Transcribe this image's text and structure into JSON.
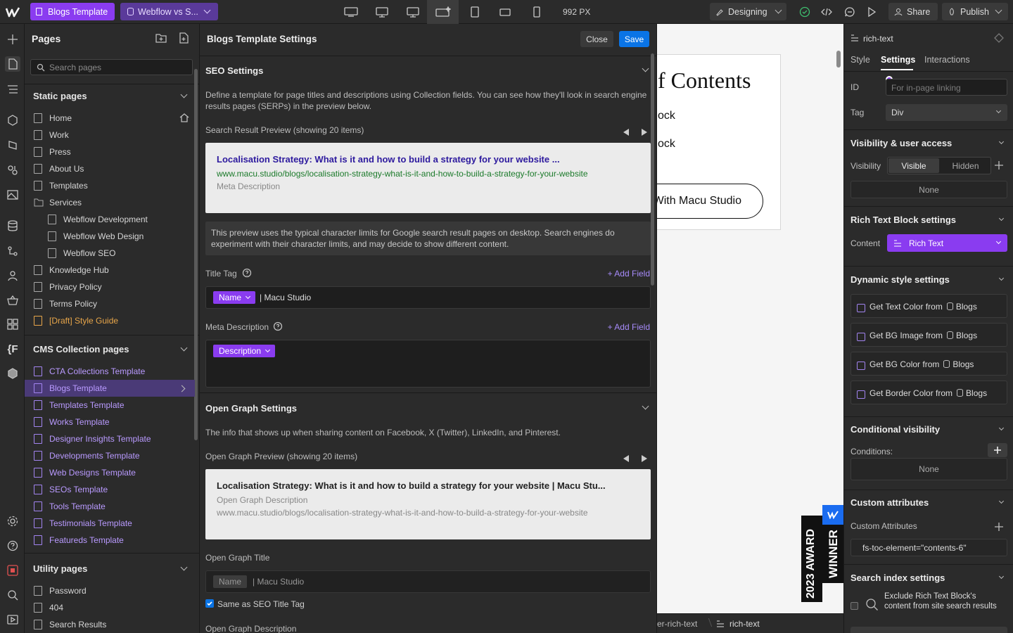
{
  "topbar": {
    "page_pill": "Blogs Template",
    "site_pill": "Webflow vs S...",
    "width_label": "992 PX",
    "mode_label": "Designing",
    "share_label": "Share",
    "publish_label": "Publish"
  },
  "pages_panel": {
    "title": "Pages",
    "search_placeholder": "Search pages",
    "static_title": "Static pages",
    "static_pages": [
      "Home",
      "Work",
      "Press",
      "About Us",
      "Templates",
      "Services",
      "Webflow Development",
      "Webflow Web Design",
      "Webflow SEO",
      "Knowledge Hub",
      "Privacy Policy",
      "Terms Policy",
      "[Draft] Style Guide"
    ],
    "cms_title": "CMS Collection pages",
    "cms_pages": [
      "CTA Collections Template",
      "Blogs Template",
      "Templates Template",
      "Works Template",
      "Designer Insights Template",
      "Developments Template",
      "Web Designs Template",
      "SEOs Template",
      "Tools Template",
      "Testimonials Template",
      "Featureds Template"
    ],
    "utility_title": "Utility pages",
    "utility_pages": [
      "Password",
      "404",
      "Search Results"
    ]
  },
  "settings": {
    "title": "Blogs Template Settings",
    "close_label": "Close",
    "save_label": "Save",
    "seo_title": "SEO Settings",
    "seo_desc": "Define a template for page titles and descriptions using Collection fields. You can see how they'll look in search engine results pages (SERPs) in the preview below.",
    "serp_label": "Search Result Preview (showing 20 items)",
    "serp_title": "Localisation Strategy: What is it and how to build a strategy for your website ...",
    "serp_url": "www.macu.studio/blogs/localisation-strategy-what-is-it-and-how-to-build-a-strategy-for-your-website",
    "serp_meta": "Meta Description",
    "serp_note": "This preview uses the typical character limits for Google search result pages on desktop. Search engines do experiment with their character limits, and may decide to show different content.",
    "title_tag_label": "Title Tag",
    "add_field": "+ Add Field",
    "name_token": "Name",
    "title_suffix": "| Macu Studio",
    "meta_desc_label": "Meta Description",
    "desc_token": "Description",
    "og_title": "Open Graph Settings",
    "og_desc": "The info that shows up when sharing content on Facebook, X (Twitter), LinkedIn, and Pinterest.",
    "og_preview_label": "Open Graph Preview (showing 20 items)",
    "og_card_title": "Localisation Strategy: What is it and how to build a strategy for your website | Macu Stu...",
    "og_card_desc": "Open Graph Description",
    "og_card_url": "www.macu.studio/blogs/localisation-strategy-what-is-it-and-how-to-build-a-strategy-for-your-website",
    "og_title_label": "Open Graph Title",
    "same_as_seo": "Same as SEO Title Tag",
    "og_desc_label": "Open Graph Description"
  },
  "canvas": {
    "heading_fragment": "f Contents",
    "line1": "ock",
    "line2": "ock",
    "button_text": "With Macu Studio",
    "badge_year": "2023 AWARD",
    "badge_winner": "WINNER",
    "crumb1": "er-rich-text",
    "crumb2": "rich-text"
  },
  "right_panel": {
    "element_name": "rich-text",
    "tabs": [
      "Style",
      "Settings",
      "Interactions"
    ],
    "id_label": "ID",
    "id_placeholder": "For in-page linking",
    "tag_label": "Tag",
    "tag_value": "Div",
    "visibility_title": "Visibility & user access",
    "visibility_label": "Visibility",
    "visible_label": "Visible",
    "hidden_label": "Hidden",
    "none_label": "None",
    "rich_title": "Rich Text Block settings",
    "content_label": "Content",
    "content_value": "Rich Text",
    "dynamic_title": "Dynamic style settings",
    "dynamic_items": [
      "Get Text Color from",
      "Get BG Image from",
      "Get BG Color from",
      "Get Border Color from"
    ],
    "collection": "Blogs",
    "cond_title": "Conditional visibility",
    "conditions_label": "Conditions:",
    "cond_none": "None",
    "custom_title": "Custom attributes",
    "custom_label": "Custom Attributes",
    "custom_value": "fs-toc-element=\"contents-6\"",
    "search_title": "Search index settings",
    "exclude_text": "Exclude Rich Text Block's content from site search results"
  },
  "colors": {
    "accent": "#8a3cf0",
    "save": "#0a74e6",
    "link_title": "#2d1a9e",
    "link_url": "#1b7a2a"
  }
}
